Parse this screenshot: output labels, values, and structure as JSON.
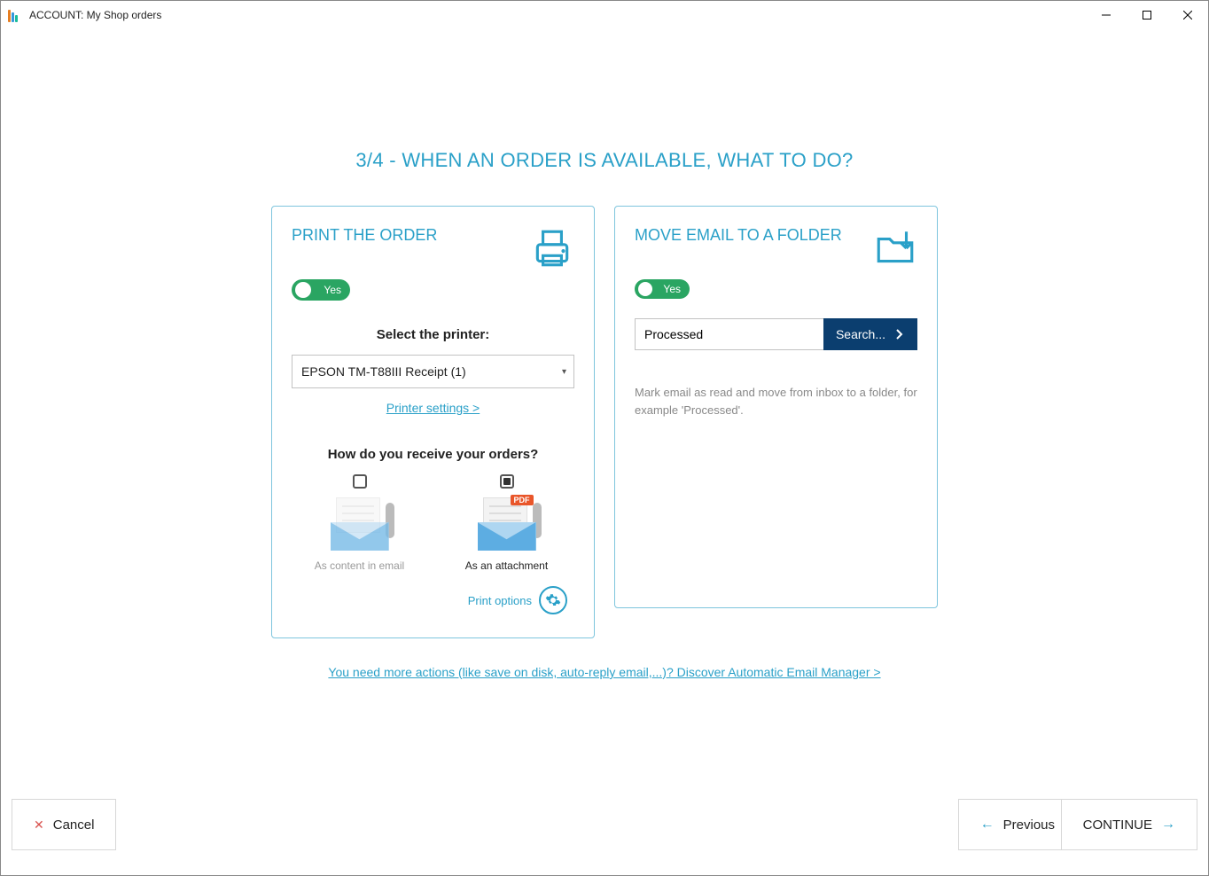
{
  "window": {
    "title": "ACCOUNT: My Shop orders"
  },
  "heading": "3/4 - WHEN AN ORDER IS AVAILABLE, WHAT TO DO?",
  "left_card": {
    "title": "PRINT THE ORDER",
    "toggle_label": "Yes",
    "select_label": "Select the printer:",
    "selected_printer": "EPSON TM-T88III Receipt (1)",
    "settings_link": "Printer settings >",
    "subsection": "How do you receive your orders?",
    "option_a": "As content in email",
    "option_b": "As an attachment",
    "print_options": "Print options"
  },
  "right_card": {
    "title": "MOVE EMAIL TO A FOLDER",
    "toggle_label": "Yes",
    "folder_value": "Processed",
    "search_label": "Search...",
    "hint": "Mark email as read and move from inbox to a folder, for example 'Processed'."
  },
  "discover_link": "You need more actions (like save on disk, auto-reply email,...)? Discover Automatic Email Manager >",
  "buttons": {
    "cancel": "Cancel",
    "previous": "Previous",
    "continue": "CONTINUE"
  }
}
